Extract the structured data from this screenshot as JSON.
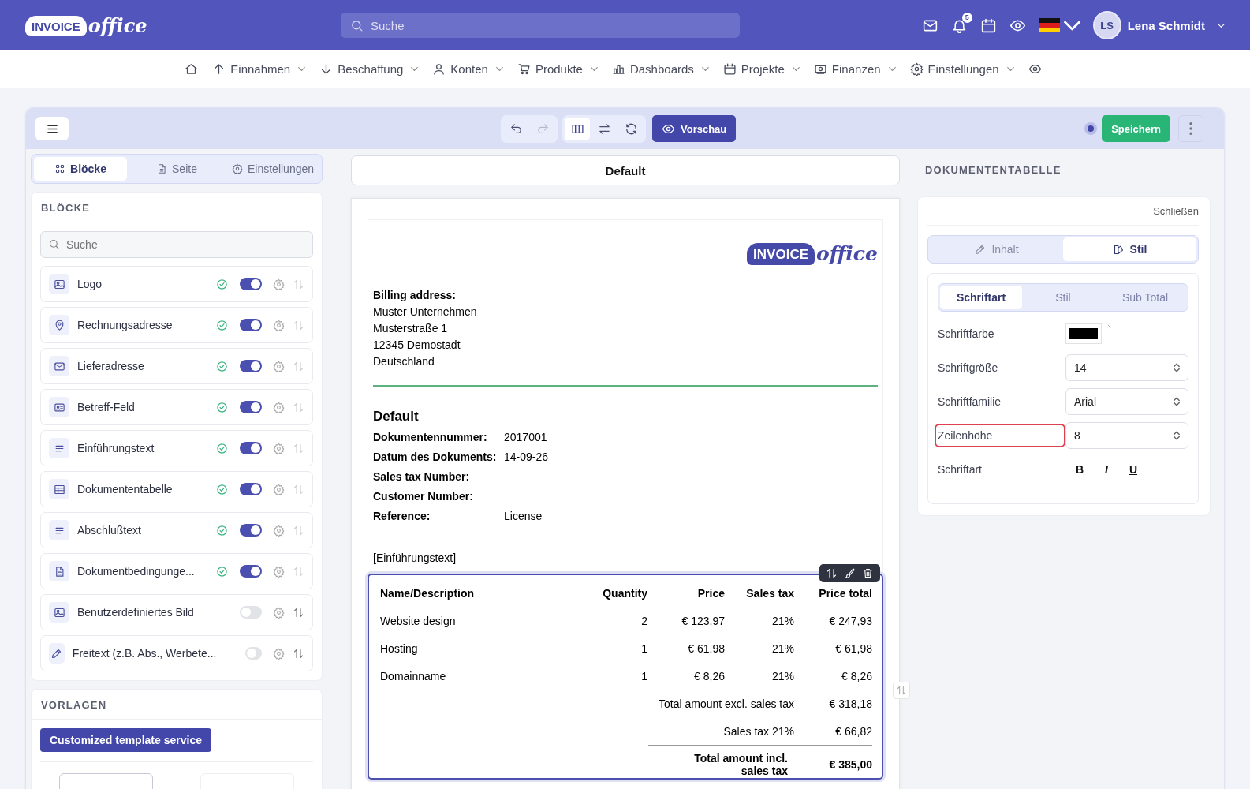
{
  "logo": {
    "badge": "INVOICE",
    "script": "office"
  },
  "document_logo": {
    "badge": "INVOICE",
    "script": "office"
  },
  "header": {
    "search_placeholder": "Suche",
    "notification_count": "5",
    "user_initials": "LS",
    "user_name": "Lena Schmidt"
  },
  "nav": [
    {
      "kind": "icon"
    },
    {
      "kind": "menu",
      "label": "Einnahmen"
    },
    {
      "kind": "menu",
      "label": "Beschaffung"
    },
    {
      "kind": "menu",
      "label": "Konten"
    },
    {
      "kind": "menu",
      "label": "Produkte"
    },
    {
      "kind": "menu",
      "label": "Dashboards"
    },
    {
      "kind": "menu",
      "label": "Projekte"
    },
    {
      "kind": "menu",
      "label": "Finanzen"
    },
    {
      "kind": "menu",
      "label": "Einstellungen"
    },
    {
      "kind": "icon"
    }
  ],
  "toolbar": {
    "preview": "Vorschau",
    "save": "Speichern"
  },
  "left_tabs": [
    {
      "label": "Blöcke",
      "selected": true
    },
    {
      "label": "Seite",
      "selected": false
    },
    {
      "label": "Einstellungen",
      "selected": false
    }
  ],
  "blocks": {
    "title": "BLÖCKE",
    "search_placeholder": "Suche",
    "items": [
      {
        "label": "Logo",
        "on": true
      },
      {
        "label": "Rechnungsadresse",
        "on": true
      },
      {
        "label": "Lieferadresse",
        "on": true
      },
      {
        "label": "Betreff-Feld",
        "on": true
      },
      {
        "label": "Einführungstext",
        "on": true
      },
      {
        "label": "Dokumententabelle",
        "on": true
      },
      {
        "label": "Abschlußtext",
        "on": true
      },
      {
        "label": "Dokumentbedingunge...",
        "on": true
      },
      {
        "label": "Benutzerdefiniertes Bild",
        "on": false
      },
      {
        "label": "Freitext (z.B. Abs., Werbete...",
        "on": false
      }
    ]
  },
  "templates": {
    "title": "VORLAGEN",
    "button": "Customized template service"
  },
  "document_title": "Default",
  "document": {
    "billing_title": "Billing address:",
    "address": [
      "Muster Unternehmen",
      "Musterstraße 1",
      "12345 Demostadt",
      "Deutschland"
    ],
    "heading": "Default",
    "meta": [
      {
        "label": "Dokumentennummer:",
        "value": "2017001"
      },
      {
        "label": "Datum des Dokuments:",
        "value": "14-09-26"
      },
      {
        "label": "Sales tax Number:"
      },
      {
        "label": "Customer Number:"
      },
      {
        "label": "Reference:",
        "value": "License"
      }
    ],
    "intro": "[Einführungstext]",
    "table": {
      "columns": [
        "Name/Description",
        "Quantity",
        "Price",
        "Sales tax",
        "Price total"
      ],
      "rows": [
        [
          "Website design",
          "2",
          "€ 123,97",
          "21%",
          "€ 247,93"
        ],
        [
          "Hosting",
          "1",
          "€ 61,98",
          "21%",
          "€ 61,98"
        ],
        [
          "Domainname",
          "1",
          "€ 8,26",
          "21%",
          "€ 8,26"
        ]
      ],
      "totals": [
        {
          "label": "Total amount excl. sales tax",
          "value": "€ 318,18",
          "bold": false
        },
        {
          "label": "Sales tax 21%",
          "value": "€ 66,82",
          "bold": false
        },
        {
          "label": "Total amount incl. sales tax",
          "value": "€ 385,00",
          "bold": true
        }
      ]
    }
  },
  "style_panel": {
    "title": "DOKUMENTENTABELLE",
    "close": "Schließen",
    "tabs": [
      {
        "label": "Inhalt",
        "selected": false
      },
      {
        "label": "Stil",
        "selected": true
      }
    ],
    "subtabs": [
      {
        "label": "Schriftart",
        "selected": true
      },
      {
        "label": "Stil",
        "selected": false
      },
      {
        "label": "Sub Total",
        "selected": false
      }
    ],
    "fields": [
      {
        "kind": "color",
        "label": "Schriftfarbe",
        "color": "#000000",
        "highlighted": false
      },
      {
        "kind": "select",
        "label": "Schriftgröße",
        "value": "14",
        "highlighted": false
      },
      {
        "kind": "select",
        "label": "Schriftfamilie",
        "value": "Arial",
        "highlighted": false
      },
      {
        "kind": "select",
        "label": "Zeilenhöhe",
        "value": "8",
        "highlighted": true
      },
      {
        "kind": "styles",
        "label": "Schriftart",
        "options": [
          "B",
          "I",
          "U"
        ],
        "highlighted": false
      }
    ]
  }
}
